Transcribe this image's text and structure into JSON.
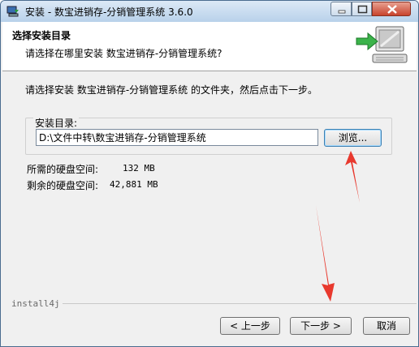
{
  "window": {
    "title": "安装 - 数宝进销存-分销管理系统 3.6.0"
  },
  "header": {
    "title": "选择安装目录",
    "subtitle": "请选择在哪里安装 数宝进销存-分销管理系统?"
  },
  "main": {
    "instruction": "请选择安装 数宝进销存-分销管理系统 的文件夹，然后点击下一步。",
    "dir_group_label": "安装目录:",
    "dir_value": "D:\\文件中转\\数宝进销存-分销管理系统",
    "browse_label": "浏览...",
    "required_label": "所需的硬盘空间:",
    "required_value": "132 MB",
    "free_label": "剩余的硬盘空间:",
    "free_value": "42,881 MB"
  },
  "footer": {
    "brand": "install4j",
    "back_label": "< 上一步",
    "next_label": "下一步 >",
    "cancel_label": "取消"
  },
  "colors": {
    "annotation_arrow": "#e8392e",
    "title_bar": "#c4d8ee"
  },
  "icons": [
    "app-installer-icon",
    "minimize-icon",
    "maximize-icon",
    "close-icon",
    "install-computer-icon"
  ]
}
